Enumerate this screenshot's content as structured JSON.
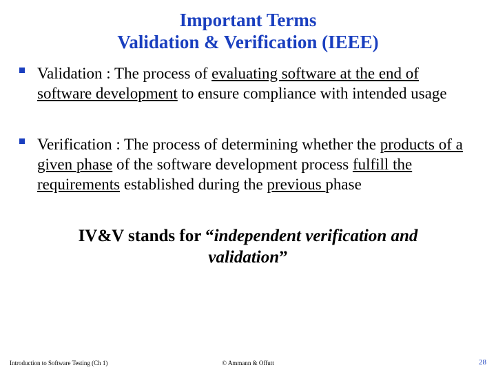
{
  "title": {
    "line1": "Important Terms",
    "line2": "Validation & Verification (IEEE)"
  },
  "bullets": [
    {
      "term": "Validation",
      "sep": " : The process of ",
      "u1": "evaluating software at the end of software development",
      "rest": " to ensure compliance with intended usage"
    },
    {
      "term": "Verification",
      "sep": " : The process of determining whether the ",
      "u1": "products of a given phase",
      "mid": " of the software development process ",
      "u2": "fulfill the requirements",
      "mid2": " established during the ",
      "u3": "previous ",
      "rest": "phase"
    }
  ],
  "ivv": {
    "lead": "IV&V stands for “",
    "ital": "independent verification and validation",
    "tail": "”"
  },
  "footer": {
    "left": "Introduction to Software Testing (Ch 1)",
    "center": "© Ammann & Offutt",
    "right": "28"
  }
}
